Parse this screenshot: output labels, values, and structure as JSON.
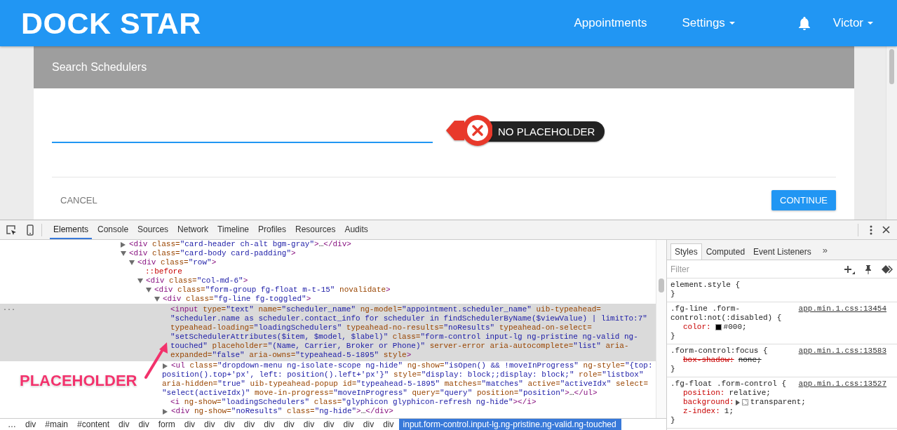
{
  "app": {
    "logo": "DOCK STAR",
    "nav": [
      {
        "label": "Appointments",
        "dropdown": false
      },
      {
        "label": "Settings",
        "dropdown": true
      }
    ],
    "user": {
      "label": "Victor",
      "dropdown": true
    }
  },
  "card": {
    "title": "Search Schedulers",
    "field": {
      "focused": true
    },
    "buttons": [
      {
        "label": "CANCEL",
        "kind": "flat"
      },
      {
        "label": "CONTINUE",
        "kind": "primary"
      }
    ]
  },
  "annotations": {
    "missing": {
      "text": "NO PLACEHOLDER"
    },
    "pointer": {
      "text": "PLACEHOLDER"
    }
  },
  "devtools": {
    "tabs": [
      {
        "label": "Elements",
        "selected": true
      },
      {
        "label": "Console",
        "selected": false
      },
      {
        "label": "Sources",
        "selected": false
      },
      {
        "label": "Network",
        "selected": false
      },
      {
        "label": "Timeline",
        "selected": false
      },
      {
        "label": "Profiles",
        "selected": false
      },
      {
        "label": "Resources",
        "selected": false
      },
      {
        "label": "Audits",
        "selected": false
      }
    ],
    "dom_tree": [
      {
        "kind": "element",
        "lines": [
          "<div class=\"card-header ch-alt bgm-gray\">…</div>"
        ],
        "expanded": false,
        "selected": false
      },
      {
        "kind": "element",
        "lines": [
          "<div class=\"card-body card-padding\">"
        ],
        "expanded": true,
        "selected": false,
        "children": [
          {
            "kind": "element",
            "lines": [
              "<div class=\"row\">"
            ],
            "expanded": true,
            "selected": false,
            "children": [
              {
                "kind": "pseudo",
                "lines": [
                  "::before"
                ],
                "selected": false
              },
              {
                "kind": "element",
                "lines": [
                  "<div class=\"col-md-6\">"
                ],
                "expanded": true,
                "selected": false,
                "children": [
                  {
                    "kind": "element",
                    "lines": [
                      "<div class=\"form-group fg-float m-t-15\" novalidate>"
                    ],
                    "expanded": true,
                    "selected": false,
                    "children": [
                      {
                        "kind": "element",
                        "lines": [
                          "<div class=\"fg-line fg-toggled\">"
                        ],
                        "expanded": true,
                        "selected": false,
                        "children": [
                          {
                            "kind": "element",
                            "selected": true,
                            "gutter": "...",
                            "lines": [
                              "<input type=\"text\" name=\"scheduler_name\" ng-model=\"appointment.scheduler_name\" uib-typeahead=",
                              "\"scheduler.name as scheduler.contact_info for scheduler in findSchedulerByName($viewValue) | limitTo:7\"",
                              "typeahead-loading=\"loadingSchedulers\" typeahead-no-results=\"noResults\" typeahead-on-select=",
                              "\"setSchedulerAttributes($item, $model, $label)\" class=\"form-control input-lg ng-pristine ng-valid ng-",
                              "touched\" placeholder=\"(Name, Carrier, Broker or Phone)\" server-error aria-autocomplete=\"list\" aria-",
                              "expanded=\"false\" aria-owns=\"typeahead-5-1895\" style>"
                            ]
                          },
                          {
                            "kind": "element",
                            "expanded": false,
                            "selected": false,
                            "lines": [
                              "<ul class=\"dropdown-menu ng-isolate-scope ng-hide\" ng-show=\"isOpen() && !moveInProgress\" ng-style=\"{top:",
                              "position().top+'px', left: position().left+'px'}\" style=\"display: block;;display: block;\" role=\"listbox\"",
                              "aria-hidden=\"true\" uib-typeahead-popup id=\"typeahead-5-1895\" matches=\"matches\" active=\"activeIdx\" select=",
                              "\"select(activeIdx)\" move-in-progress=\"moveInProgress\" query=\"query\" position=\"position\">…</ul>"
                            ]
                          },
                          {
                            "kind": "element",
                            "selected": false,
                            "lines": [
                              "<i ng-show=\"loadingSchedulers\" class=\"glyphicon glyphicon-refresh ng-hide\"></i>"
                            ]
                          },
                          {
                            "kind": "element",
                            "expanded": false,
                            "selected": false,
                            "lines": [
                              "<div ng-show=\"noResults\" class=\"ng-hide\">…</div>"
                            ]
                          }
                        ]
                      }
                    ]
                  }
                ]
              }
            ]
          }
        ]
      }
    ],
    "breadcrumbs": [
      {
        "label": "…",
        "selected": false
      },
      {
        "label": "div",
        "selected": false
      },
      {
        "label": "#main",
        "selected": false
      },
      {
        "label": "#content",
        "selected": false
      },
      {
        "label": "div",
        "selected": false
      },
      {
        "label": "div",
        "selected": false
      },
      {
        "label": "form",
        "selected": false
      },
      {
        "label": "div",
        "selected": false
      },
      {
        "label": "div",
        "selected": false
      },
      {
        "label": "div",
        "selected": false
      },
      {
        "label": "div",
        "selected": false
      },
      {
        "label": "div",
        "selected": false
      },
      {
        "label": "div",
        "selected": false
      },
      {
        "label": "div",
        "selected": false
      },
      {
        "label": "div",
        "selected": false
      },
      {
        "label": "div",
        "selected": false
      },
      {
        "label": "div",
        "selected": false
      },
      {
        "label": "div",
        "selected": false
      },
      {
        "label": "input.form-control.input-lg.ng-pristine.ng-valid.ng-touched",
        "selected": true
      }
    ],
    "sidebar": {
      "tabs": [
        {
          "label": "Styles",
          "selected": true
        },
        {
          "label": "Computed",
          "selected": false
        },
        {
          "label": "Event Listeners",
          "selected": false
        }
      ],
      "more": "»",
      "filter": {
        "placeholder": "Filter"
      },
      "rules": [
        {
          "selector": [
            "element.style {"
          ],
          "closing": "}"
        },
        {
          "selector": [
            ".fg-line .form-",
            "control:not(:disabled) {"
          ],
          "source": "app.min.1.css:13454",
          "closing": "}",
          "properties": [
            {
              "name": "color:",
              "value": "#000;",
              "struck": false,
              "swatch": {
                "kind": "color",
                "color": "#000000"
              }
            }
          ]
        },
        {
          "selector": [
            ".form-control:focus {"
          ],
          "source": "app.min.1.css:13583",
          "closing": "}",
          "properties": [
            {
              "name": "box-shadow:",
              "value": "none;",
              "struck": true
            }
          ]
        },
        {
          "selector": [
            ".fg-float .form-control {"
          ],
          "source": "app.min.1.css:13527",
          "closing": "}",
          "properties": [
            {
              "name": "position:",
              "value": "relative;",
              "struck": false
            },
            {
              "name": "background:",
              "value": "transparent;",
              "struck": false,
              "expandable": true,
              "swatch": {
                "kind": "checker"
              }
            },
            {
              "name": "z-index:",
              "value": "1;",
              "struck": false
            }
          ]
        }
      ]
    }
  }
}
